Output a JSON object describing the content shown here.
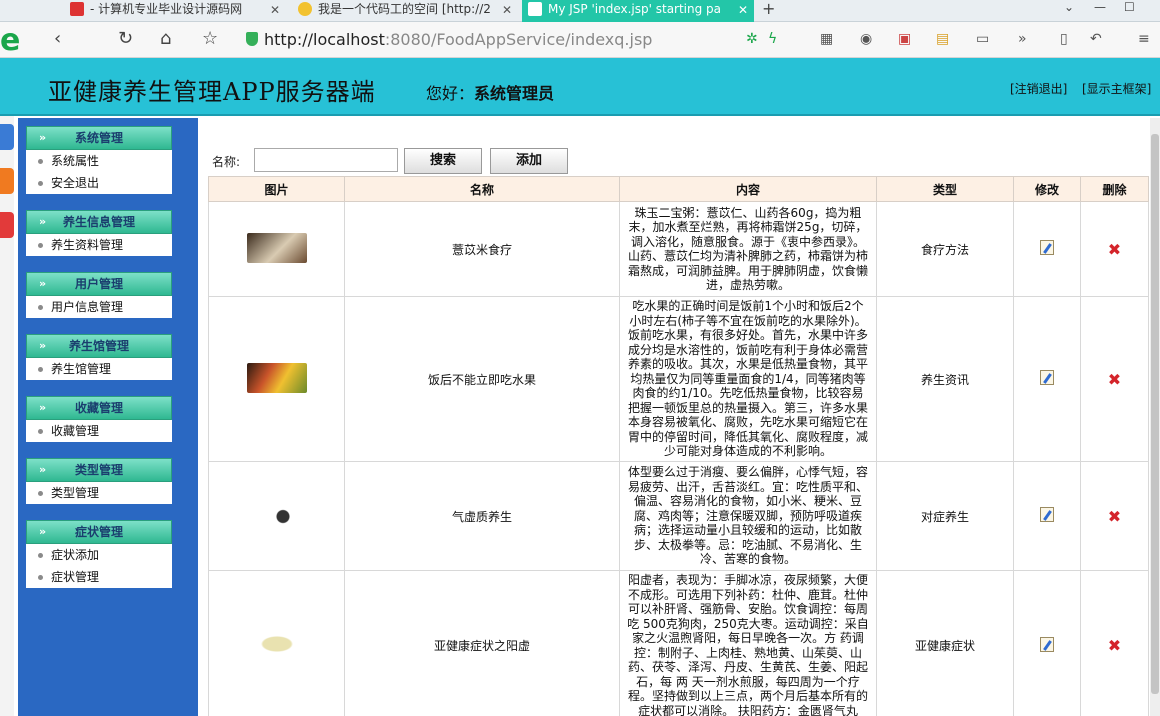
{
  "browser": {
    "tabs": [
      {
        "title": "- 计算机专业毕业设计源码网",
        "active": false
      },
      {
        "title": "我是一个代码工的空间 [http://2",
        "active": false
      },
      {
        "title": "My JSP 'index.jsp' starting pa",
        "active": true
      }
    ],
    "new_tab": "+",
    "url_host": "http://localhost",
    "url_rest": ":8080/FoodAppService/indexq.jsp"
  },
  "header": {
    "title": "亚健康养生管理APP服务器端",
    "greeting_prefix": "您好：",
    "greeting_user": "系统管理员",
    "logout_link": "[注销退出]",
    "show_frame_link": "[显示主框架]"
  },
  "sidebar": {
    "groups": [
      {
        "title": "系统管理",
        "items": [
          "系统属性",
          "安全退出"
        ]
      },
      {
        "title": "养生信息管理",
        "items": [
          "养生资料管理"
        ]
      },
      {
        "title": "用户管理",
        "items": [
          "用户信息管理"
        ]
      },
      {
        "title": "养生馆管理",
        "items": [
          "养生馆管理"
        ]
      },
      {
        "title": "收藏管理",
        "items": [
          "收藏管理"
        ]
      },
      {
        "title": "类型管理",
        "items": [
          "类型管理"
        ]
      },
      {
        "title": "症状管理",
        "items": [
          "症状添加",
          "症状管理"
        ]
      }
    ]
  },
  "search": {
    "label": "名称:",
    "value": "",
    "search_button": "搜索",
    "add_button": "添加"
  },
  "table": {
    "columns": [
      "图片",
      "名称",
      "内容",
      "类型",
      "修改",
      "删除"
    ],
    "rows": [
      {
        "name": "薏苡米食疗",
        "content": "珠玉二宝粥：薏苡仁、山药各60g，捣为粗末，加水煮至烂熟，再将柿霜饼25g，切碎，调入溶化，随意服食。源于《衷中参西录》。山药、薏苡仁均为清补脾肺之药，柿霜饼为柿霜熬成，可润肺益脾。用于脾肺阴虚，饮食懒进，虚热劳嗽。",
        "type": "食疗方法",
        "thumb_color": "#6a4a30"
      },
      {
        "name": "饭后不能立即吃水果",
        "content": "吃水果的正确时间是饭前1个小时和饭后2个小时左右(柿子等不宜在饭前吃的水果除外)。饭前吃水果，有很多好处。首先，水果中许多成分均是水溶性的，饭前吃有利于身体必需营养素的吸收。其次，水果是低热量食物，其平均热量仅为同等重量面食的1/4，同等猪肉等肉食的约1/10。先吃低热量食物，比较容易把握一顿饭里总的热量摄入。第三，许多水果本身容易被氧化、腐败，先吃水果可缩短它在胃中的停留时间，降低其氧化、腐败程度，减少可能对身体造成的不利影响。",
        "type": "养生资讯",
        "thumb_color": "#c9542a"
      },
      {
        "name": "气虚质养生",
        "content": "体型要么过于消瘦、要么偏胖，心悸气短，容易疲劳、出汗，舌苔淡红。宜：吃性质平和、偏温、容易消化的食物，如小米、粳米、豆腐、鸡肉等；注意保暖双脚，预防呼吸道疾病；选择运动量小且较缓和的运动，比如散步、太极拳等。忌：吃油腻、不易消化、生冷、苦寒的食物。",
        "type": "对症养生",
        "thumb_color": "#ffffff"
      },
      {
        "name": "亚健康症状之阳虚",
        "content": "阳虚者，表现为：手脚冰凉，夜尿频繁，大便不成形。可选用下列补药：杜仲、鹿茸。杜仲可以补肝肾、强筋骨、安胎。饮食调控：每周吃 500克狗肉，250克大枣。运动调控：采自家之火温煦肾阳，每日早晚各一次。方 药调控：制附子、上肉桂、熟地黄、山茱萸、山药、茯苓、泽泻、丹皮、生黄芪、生姜、阳起石，每 两 天一剂水煎服，每四周为一个疗程。坚持做到以上三点，两个月后基本所有的症状都可以消除。 扶阳药方：金匮肾气丸",
        "type": "亚健康症状",
        "thumb_color": "#e9e2b0"
      }
    ]
  },
  "colors": {
    "header_bg": "#27c1d6",
    "sidebar_bg": "#2a68c2",
    "group_header": "#2fb891",
    "table_header_bg": "#fdf0e4",
    "delete_red": "#d4242b"
  }
}
